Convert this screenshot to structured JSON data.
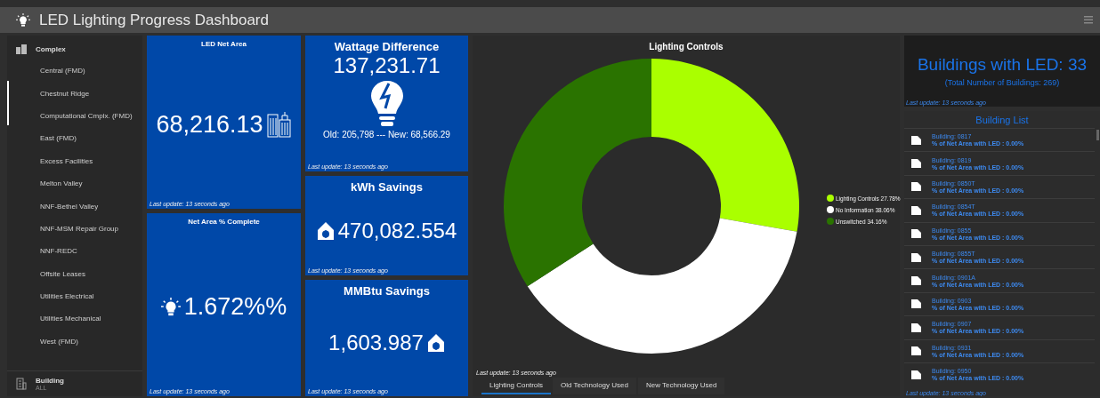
{
  "header": {
    "title": "LED Lighting Progress Dashboard"
  },
  "sidebar": {
    "group": "Complex",
    "items": [
      {
        "label": "Central (FMD)",
        "selected": false
      },
      {
        "label": "Chestnut Ridge",
        "selected": false
      },
      {
        "label": "Computational Cmplx. (FMD)",
        "selected": false
      },
      {
        "label": "East (FMD)",
        "selected": false
      },
      {
        "label": "Excess Facilities",
        "selected": false
      },
      {
        "label": "Melton Valley",
        "selected": false
      },
      {
        "label": "NNF-Bethel Valley",
        "selected": false
      },
      {
        "label": "NNF-MSM Repair Group",
        "selected": false
      },
      {
        "label": "NNF-REDC",
        "selected": false
      },
      {
        "label": "Offsite Leases",
        "selected": false
      },
      {
        "label": "Utilities Electrical",
        "selected": false
      },
      {
        "label": "Utilities Mechanical",
        "selected": false
      },
      {
        "label": "West (FMD)",
        "selected": false
      }
    ],
    "filter": {
      "label": "Building",
      "value": "ALL"
    }
  },
  "cards": [
    {
      "kind": "area",
      "title": "LED Net Area",
      "value": "68,216.13",
      "updated": "Last update: 13 seconds ago"
    },
    {
      "kind": "percent",
      "title": "Net Area % Complete",
      "value": "1.672%%",
      "updated": "Last update: 13 seconds ago"
    },
    {
      "kind": "wattage",
      "title": "Wattage Difference",
      "value": "137,231.71",
      "detail": "Old: 205,798 --- New: 68,566.29",
      "updated": "Last update: 13 seconds ago"
    },
    {
      "kind": "kwh",
      "title": "kWh Savings",
      "value": "470,082.554",
      "updated": "Last update: 13 seconds ago"
    },
    {
      "kind": "mmbtu",
      "title": "MMBtu Savings",
      "value": "1,603.987",
      "updated": "Last update: 13 seconds ago"
    }
  ],
  "chart_panel": {
    "title": "Lighting Controls",
    "updated": "Last update: 13 seconds ago",
    "legend": [
      {
        "value": "27.78%",
        "color": "#aaff00"
      },
      {
        "value": "38.06%",
        "color": "#ffffff"
      },
      {
        "value": "34.16%",
        "color": "#2a7300"
      }
    ],
    "chart_data": {
      "type": "donut",
      "categories": [
        "Lighting Controls",
        "No Information",
        "Unswitched"
      ],
      "values": [
        27.78,
        38.06,
        34.16
      ]
    },
    "tabs": [
      {
        "label": "Lighting Controls",
        "selected": true
      },
      {
        "label": "Old Technology Used",
        "selected": false
      },
      {
        "label": "New Technology Used",
        "selected": false
      }
    ]
  },
  "summary": {
    "title": "Buildings with LED: 33",
    "subtitle": "(Total Number of Buildings: 269)",
    "updated": "Last update: 13 seconds ago"
  },
  "building_list": {
    "title": "Building List",
    "updated": "Last update: 13 seconds ago",
    "items": [
      {
        "name": "Building: 0817",
        "detail": "% of Net Area with LED : 0.00%"
      },
      {
        "name": "Building: 0819",
        "detail": "% of Net Area with LED : 0.00%"
      },
      {
        "name": "Building: 0850T",
        "detail": "% of Net Area with LED : 0.00%"
      },
      {
        "name": "Building: 0854T",
        "detail": "% of Net Area with LED : 0.00%"
      },
      {
        "name": "Building: 0855",
        "detail": "% of Net Area with LED : 0.00%"
      },
      {
        "name": "Building: 0855T",
        "detail": "% of Net Area with LED : 0.00%"
      },
      {
        "name": "Building: 0901A",
        "detail": "% of Net Area with LED : 0.00%"
      },
      {
        "name": "Building: 0903",
        "detail": "% of Net Area with LED : 0.00%"
      },
      {
        "name": "Building: 0907",
        "detail": "% of Net Area with LED : 0.00%"
      },
      {
        "name": "Building: 0931",
        "detail": "% of Net Area with LED : 0.00%"
      },
      {
        "name": "Building: 0950",
        "detail": "% of Net Area with LED : 0.00%"
      }
    ]
  }
}
